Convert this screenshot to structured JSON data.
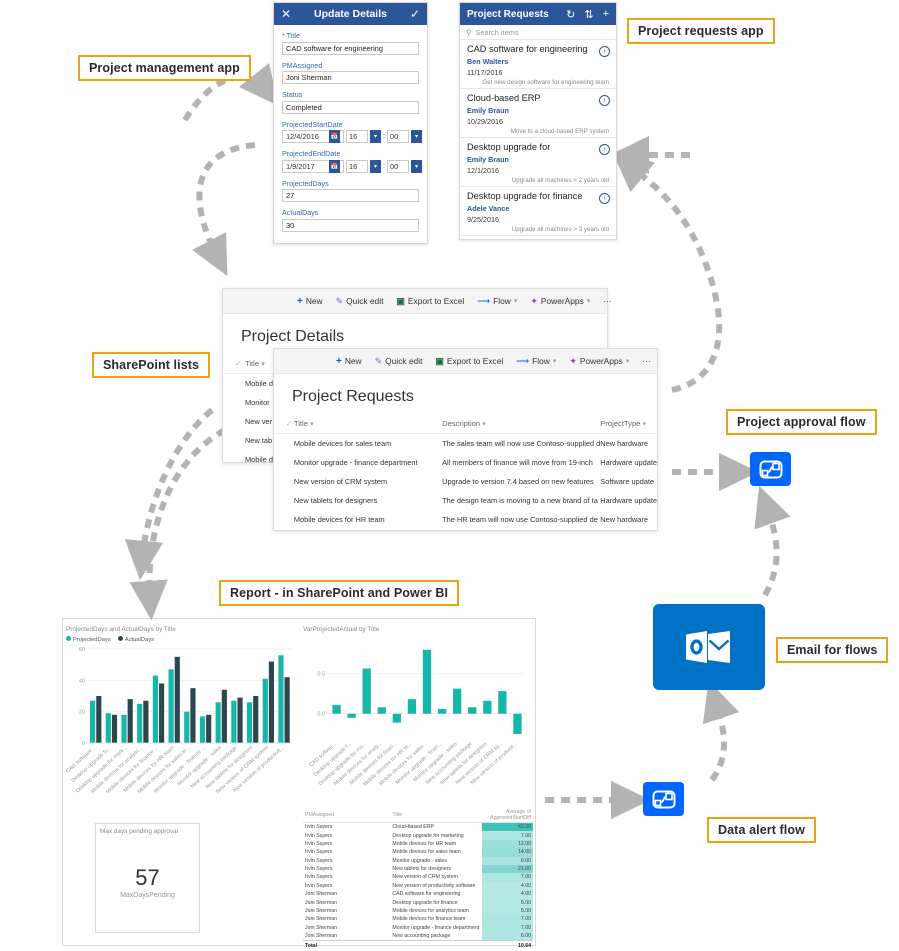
{
  "callouts": {
    "project_management_app": "Project management app",
    "project_requests_app": "Project requests app",
    "sharepoint_lists": "SharePoint lists",
    "project_approval_flow": "Project approval flow",
    "report": "Report - in SharePoint and Power BI",
    "email_for_flows": "Email for flows",
    "data_alert_flow": "Data alert flow"
  },
  "powerapps_form": {
    "title": "Update Details",
    "close_icon": "close-icon",
    "confirm_icon": "checkmark-icon",
    "fields": [
      {
        "label": "* Title",
        "value": "CAD software for engineering"
      },
      {
        "label": "PMAssigned",
        "value": "Joni Sherman"
      },
      {
        "label": "Status",
        "value": "Completed"
      }
    ],
    "start_date": {
      "label": "ProjectedStartDate",
      "value": "12/4/2016",
      "hour": "16",
      "minute": "00"
    },
    "end_date": {
      "label": "ProjectedEndDate",
      "value": "1/9/2017",
      "hour": "16",
      "minute": "00"
    },
    "projected_days": {
      "label": "ProjectedDays",
      "value": "27"
    },
    "actual_days": {
      "label": "ActualDays",
      "value": "30"
    }
  },
  "powerapps_list": {
    "title": "Project Requests",
    "refresh_icon": "refresh-icon",
    "sort_icon": "sort-icon",
    "add_icon": "plus-icon",
    "search_placeholder": "Search items",
    "search_icon": "search-icon",
    "items": [
      {
        "title": "CAD software for engineering",
        "person": "Ben Walters",
        "date": "11/17/2016",
        "desc": "Get new design software for engineering team"
      },
      {
        "title": "Cloud-based ERP",
        "person": "Emily Braun",
        "date": "10/29/2016",
        "desc": "Move to a cloud-based ERP system"
      },
      {
        "title": "Desktop upgrade for",
        "person": "Emily Braun",
        "date": "12/1/2016",
        "desc": "Upgrade all machines > 2 years old"
      },
      {
        "title": "Desktop upgrade for finance",
        "person": "Adele Vance",
        "date": "9/25/2016",
        "desc": "Upgrade all machines > 3 years old"
      }
    ]
  },
  "sharepoint_commands": [
    "New",
    "Quick edit",
    "Export to Excel",
    "Flow",
    "PowerApps",
    "···"
  ],
  "sp_project_details": {
    "title": "Project Details",
    "columns": [
      "Title"
    ],
    "rows": [
      [
        "Mobile d"
      ],
      [
        "Monitor"
      ],
      [
        "New ver"
      ],
      [
        "New tab"
      ],
      [
        "Mobile d"
      ]
    ]
  },
  "sp_project_requests": {
    "title": "Project Requests",
    "columns": [
      "Title",
      "Description",
      "ProjectType"
    ],
    "rows": [
      [
        "Mobile devices for sales team",
        "The sales team will now use Contoso-supplied d",
        "New hardware"
      ],
      [
        "Monitor upgrade - finance department",
        "All members of finance will move from 19-inch",
        "Hardware update"
      ],
      [
        "New version of CRM system",
        "Upgrade to version 7.4 based on new features",
        "Software update"
      ],
      [
        "New tablets for designers",
        "The design team is moving to a new brand of ta",
        "Hardware update"
      ],
      [
        "Mobile devices for HR team",
        "The HR team will now use Contoso-supplied de",
        "New hardware"
      ]
    ]
  },
  "chart_data": [
    {
      "type": "bar",
      "title": "ProjectedDays and ActualDays by Title",
      "xlabel": "",
      "ylabel": "",
      "ylim": [
        0,
        60
      ],
      "yticks": [
        0,
        20,
        40,
        60
      ],
      "grid": true,
      "legend": [
        "ProjectedDays",
        "ActualDays"
      ],
      "legend_position": "top-left",
      "colors": [
        "#16b6a8",
        "#2e4650"
      ],
      "categories": [
        "CAD software...",
        "Desktop upgrade fo...",
        "Desktop upgrade for mark...",
        "Mobile devices for analytic...",
        "Mobile devices for finance ...",
        "Mobile devices for HR team",
        "Mobile devices for sales te...",
        "Monitor upgrade - finance ...",
        "Monitor upgrade - sales",
        "New accounting package",
        "New tablets for designers",
        "New version of CRM system",
        "New version of productivit..."
      ],
      "series": [
        {
          "name": "ProjectedDays",
          "values": [
            27,
            19,
            18,
            25,
            43,
            47,
            20,
            17,
            26,
            27,
            26,
            41,
            56
          ]
        },
        {
          "name": "ActualDays",
          "values": [
            30,
            18,
            28,
            27,
            38,
            55,
            35,
            18,
            34,
            29,
            30,
            52,
            42
          ]
        }
      ]
    },
    {
      "type": "bar",
      "title": "VarProjectedActual by Title",
      "xlabel": "",
      "ylabel": "",
      "ylim": [
        -0.3,
        0.85
      ],
      "yticks": [
        0.0,
        0.5
      ],
      "ytick_labels": [
        "0.0",
        "0.5"
      ],
      "grid": true,
      "colors": [
        "#16b6a8"
      ],
      "categories": [
        "CAD softwar...",
        "Desktop upgrade f...",
        "Desktop upgrade for ma...",
        "Mobile devices for analy...",
        "Mobile devices for finan...",
        "Mobile devices for HR te...",
        "Mobile devices for sales...",
        "Monitor upgrade - finan...",
        "Monitor upgrade - sales",
        "New accounting package",
        "New tablets for designers",
        "New version of CRM sy...",
        "New version of producti..."
      ],
      "values": [
        0.11,
        -0.05,
        0.56,
        0.08,
        -0.11,
        0.18,
        0.79,
        0.06,
        0.31,
        0.08,
        0.16,
        0.28,
        -0.25
      ]
    },
    {
      "type": "table",
      "title": "",
      "columns": [
        "PMAssigned",
        "Title",
        "Average of ApprovedStartDiff"
      ],
      "rows": [
        [
          "Irvin Sayers",
          "Cloud-based ERP",
          "42.00"
        ],
        [
          "Irvin Sayers",
          "Desktop upgrade for marketing",
          "7.00"
        ],
        [
          "Irvin Sayers",
          "Mobile devices for HR team",
          "12.00"
        ],
        [
          "Irvin Sayers",
          "Mobile devices for sales team",
          "14.00"
        ],
        [
          "Irvin Sayers",
          "Monitor upgrade - sales",
          "8.00"
        ],
        [
          "Irvin Sayers",
          "New tablets for designers",
          "21.00"
        ],
        [
          "Irvin Sayers",
          "New version of CRM system",
          "7.00"
        ],
        [
          "Irvin Sayers",
          "New version of productivity software",
          "4.00"
        ],
        [
          "Joni Sherman",
          "CAD software for engineering",
          "4.00"
        ],
        [
          "Joni Sherman",
          "Desktop upgrade for finance",
          "5.00"
        ],
        [
          "Joni Sherman",
          "Mobile devices for analytics team",
          "5.00"
        ],
        [
          "Joni Sherman",
          "Mobile devices for finance team",
          "7.00"
        ],
        [
          "Joni Sherman",
          "Monitor upgrade - finance department",
          "7.00"
        ],
        [
          "Joni Sherman",
          "New accounting package",
          "6.00"
        ]
      ],
      "total_label": "Total",
      "total_value": "10.64",
      "heat_color": "#16b6a8"
    },
    {
      "type": "card",
      "title": "Max days pending approval",
      "value": "57",
      "label": "MaxDaysPending"
    }
  ],
  "icons": {
    "flow_approval": "microsoft-flow-icon",
    "flow_alert": "microsoft-flow-icon",
    "outlook": "outlook-icon"
  },
  "colors": {
    "accent_teal": "#16b6a8",
    "dark_teal": "#2e4650",
    "sharepoint_blue": "#2b579a",
    "flow_blue": "#0066ff",
    "outlook_blue": "#0072c6",
    "callout_border": "#e8a317"
  }
}
